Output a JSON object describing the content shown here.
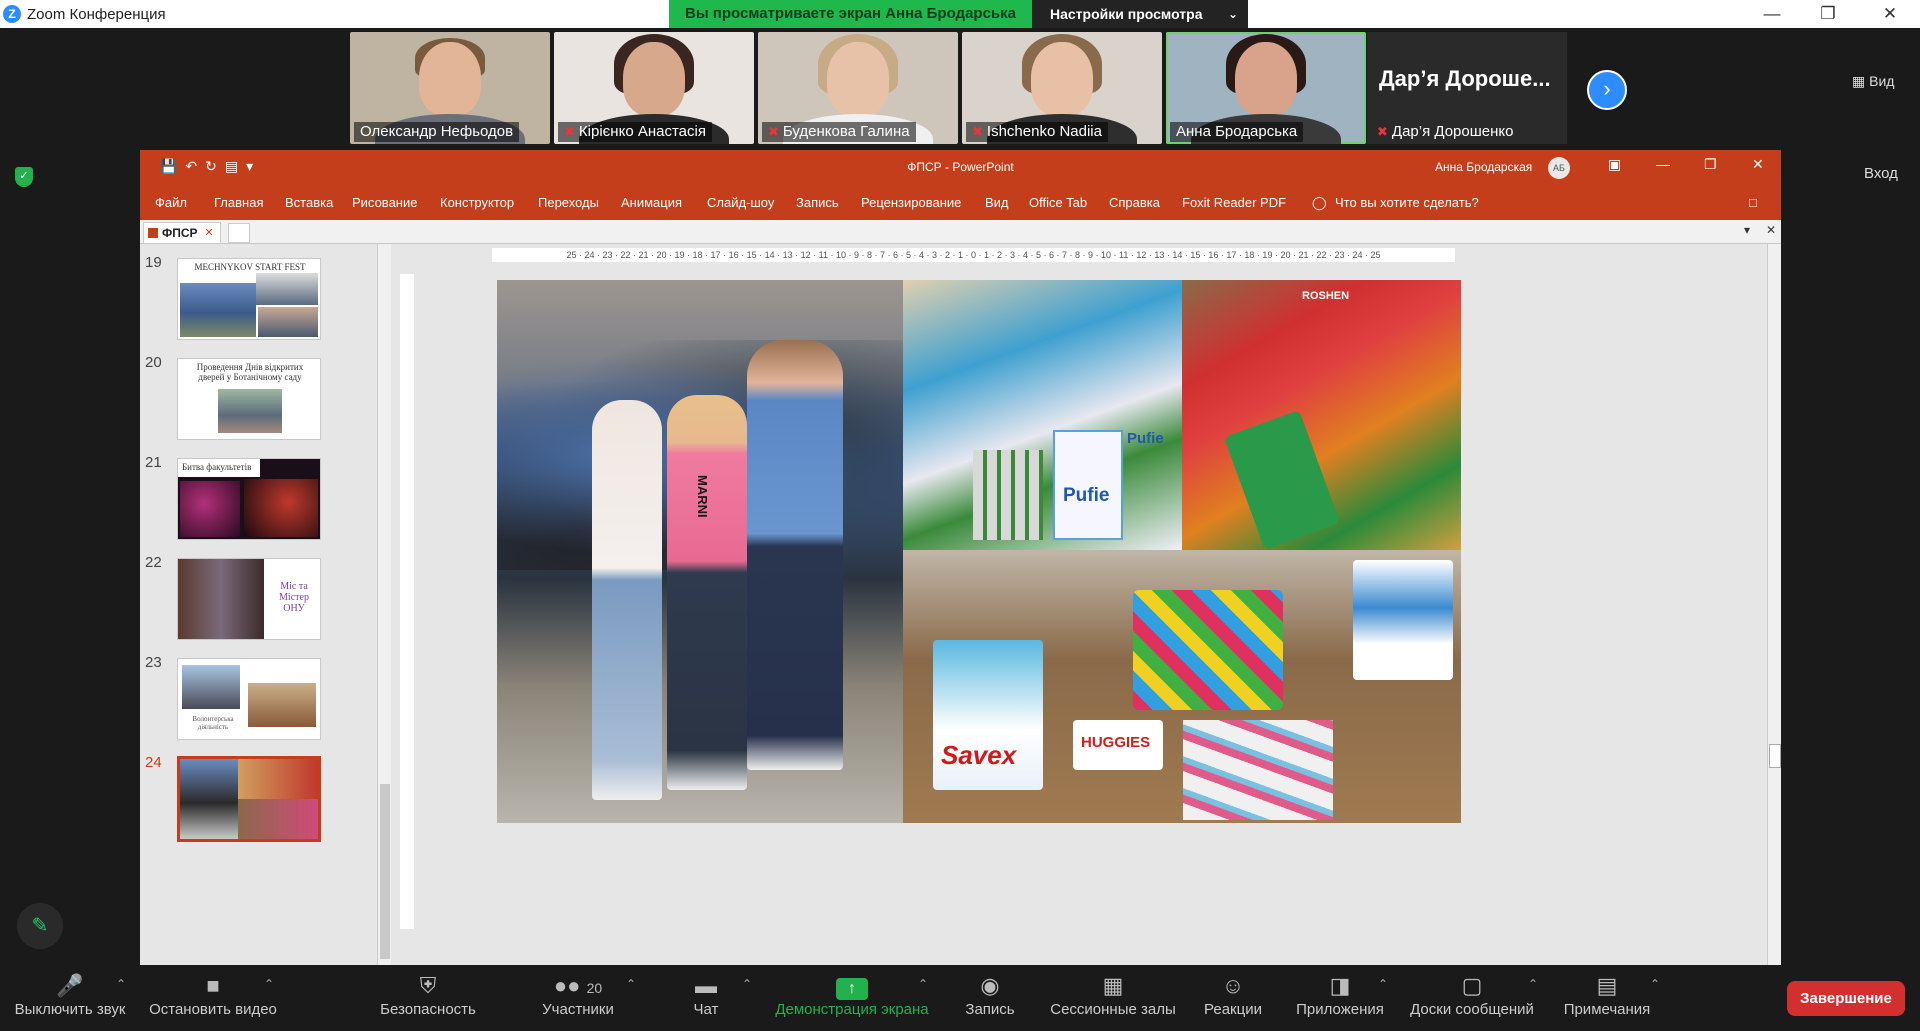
{
  "window": {
    "app_title": "Zoom Конференция",
    "share_banner": "Вы просматриваете экран Анна Бродарська",
    "view_settings": "Настройки просмотра"
  },
  "gallery": {
    "participants": [
      {
        "name": "Олександр   Нефьодов",
        "muted": false
      },
      {
        "name": "Кірієнко Анастасія",
        "muted": true
      },
      {
        "name": "Буденкова Галина",
        "muted": true
      },
      {
        "name": "Ishchenko Nadiia",
        "muted": true
      },
      {
        "name": "Анна Бродарська",
        "muted": false
      },
      {
        "name": "Дар’я Дорошенко",
        "muted": true
      }
    ],
    "name_only_big": "Дар’я Дороше...",
    "view_label": "Вид"
  },
  "sidebar": {
    "enter_label": "Вход"
  },
  "ppt": {
    "doc_title": "ФПСР  -  PowerPoint",
    "user_name": "Анна Бродарская",
    "user_initials": "АБ",
    "ribbon": [
      "Файл",
      "Главная",
      "Вставка",
      "Рисование",
      "Конструктор",
      "Переходы",
      "Анимация",
      "Слайд-шоу",
      "Запись",
      "Рецензирование",
      "Вид",
      "Office Tab",
      "Справка",
      "Foxit Reader PDF",
      "Что вы хотите сделать?"
    ],
    "doc_tab": "ФПСР",
    "slides": [
      {
        "num": "19",
        "text": "MECHNYKOV START FEST"
      },
      {
        "num": "20",
        "text": "Проведення Днів відкритих дверей у Ботанічному саду"
      },
      {
        "num": "21",
        "text": "Битва факультетів"
      },
      {
        "num": "22",
        "text": "Міс та Містер ОНУ"
      },
      {
        "num": "23",
        "text": "Волонтерська діяльність"
      },
      {
        "num": "24",
        "text": ""
      }
    ],
    "ruler_labels": "25 · 24 · 23 · 22 · 21 · 20 · 19 · 18 · 17 · 16 · 15 · 14 · 13 · 12 · 11 · 10 · 9 · 8 · 7 · 6 · 5 · 4 · 3 · 2 · 1 · 0 · 1 · 2 · 3 · 4 · 5 · 6 · 7 · 8 · 9 · 10 · 11 · 12 · 13 · 14 · 15 · 16 · 17 · 18 · 19 · 20 · 21 · 22 · 23 · 24 · 25",
    "slide_text": {
      "shirt": "MARNI",
      "savex": "Savex",
      "huggies": "HUGGIES",
      "pufie1": "Pufie",
      "pufie2": "Pufie",
      "roshen": "ROSHEN"
    }
  },
  "toolbar": {
    "mute": "Выключить звук",
    "video": "Остановить видео",
    "security": "Безопасность",
    "participants": "Участники",
    "participants_count": "20",
    "chat": "Чат",
    "share": "Демонстрация экрана",
    "record": "Запись",
    "breakout": "Сессионные залы",
    "reactions": "Реакции",
    "apps": "Приложения",
    "whiteboards": "Доски сообщений",
    "notes": "Примечания",
    "end": "Завершение"
  },
  "colors": {
    "ppt_accent": "#c43e1c",
    "zoom_green": "#23b14d",
    "zoom_blue": "#2d8cff",
    "end_red": "#d32f2f"
  }
}
